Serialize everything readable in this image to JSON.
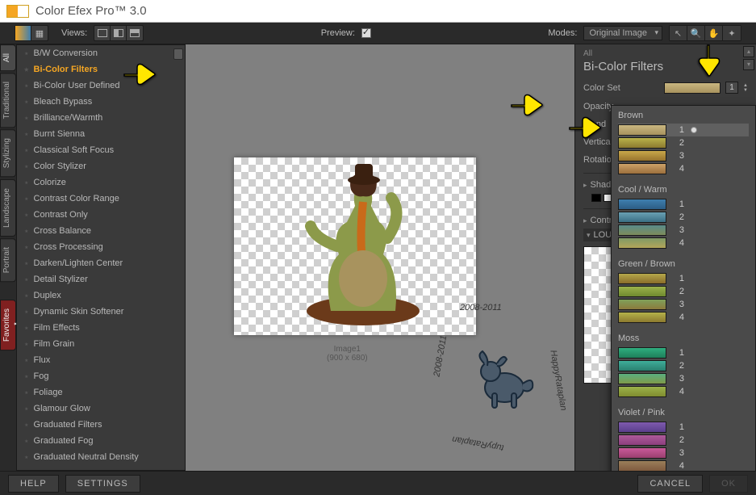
{
  "title": "Color Efex Pro™ 3.0",
  "toolbar": {
    "views_label": "Views:",
    "preview_label": "Preview:",
    "modes_label": "Modes:",
    "modes_value": "Original Image"
  },
  "vtabs": [
    "All",
    "Traditional",
    "Stylizing",
    "Landscape",
    "Portrait"
  ],
  "vtab_fav": "Favorites",
  "filters": [
    "B/W Conversion",
    "Bi-Color Filters",
    "Bi-Color User Defined",
    "Bleach Bypass",
    "Brilliance/Warmth",
    "Burnt Sienna",
    "Classical Soft Focus",
    "Color Stylizer",
    "Colorize",
    "Contrast Color Range",
    "Contrast Only",
    "Cross Balance",
    "Cross Processing",
    "Darken/Lighten Center",
    "Detail Stylizer",
    "Duplex",
    "Dynamic Skin Softener",
    "Film Effects",
    "Film Grain",
    "Flux",
    "Fog",
    "Foliage",
    "Glamour Glow",
    "Graduated Filters",
    "Graduated Fog",
    "Graduated Neutral Density"
  ],
  "selected_filter_index": 1,
  "preview": {
    "name": "Image1",
    "dims": "(900 x 680)"
  },
  "watermark": {
    "y1": "2008-2011",
    "y2": "HappyRataplan",
    "y3": "tupyRataplan",
    "y4": "2008-2011"
  },
  "right": {
    "crumb": "All",
    "title": "Bi-Color Filters",
    "rows": {
      "colorset": "Color Set",
      "opacity": "Opacity",
      "blend": "Blend",
      "vshift": "Vertical Shift",
      "rotation": "Rotation",
      "shadows": "Shadows / Highlights",
      "cpoints": "Control Points",
      "loupe": "LOUPE"
    },
    "colorset_index": "1"
  },
  "popover": {
    "groups": [
      {
        "name": "Brown",
        "swatches": [
          {
            "g": "linear-gradient(to bottom,#c9b680,#a8935e)",
            "n": "1",
            "sel": true
          },
          {
            "g": "linear-gradient(to bottom,#b9b24a,#8c7a2f)",
            "n": "2"
          },
          {
            "g": "linear-gradient(to bottom,#c9a84a,#97732d)",
            "n": "3"
          },
          {
            "g": "linear-gradient(to bottom,#cda268,#9c6f3c)",
            "n": "4"
          }
        ]
      },
      {
        "name": "Cool / Warm",
        "swatches": [
          {
            "g": "linear-gradient(to bottom,#3f7fae,#2c5d85)",
            "n": "1"
          },
          {
            "g": "linear-gradient(to bottom,#6aa0b3,#3a6f84)",
            "n": "2"
          },
          {
            "g": "linear-gradient(to bottom,#5a8b8a,#7d8c5a)",
            "n": "3"
          },
          {
            "g": "linear-gradient(to bottom,#7f9a66,#b2a55a)",
            "n": "4"
          }
        ]
      },
      {
        "name": "Green / Brown",
        "swatches": [
          {
            "g": "linear-gradient(to bottom,#b5a84a,#8a6d2a)",
            "n": "1"
          },
          {
            "g": "linear-gradient(to bottom,#9bb24a,#6f8a2f)",
            "n": "2"
          },
          {
            "g": "linear-gradient(to bottom,#7fa15a,#8c7a3c)",
            "n": "3"
          },
          {
            "g": "linear-gradient(to bottom,#b5b24a,#8c7a2f)",
            "n": "4"
          }
        ]
      },
      {
        "name": "Moss",
        "swatches": [
          {
            "g": "linear-gradient(to bottom,#2fae7f,#1e7f5a)",
            "n": "1"
          },
          {
            "g": "linear-gradient(to bottom,#3fae9a,#2a7f6f)",
            "n": "2"
          },
          {
            "g": "linear-gradient(to bottom,#5aae7f,#7f9a4a)",
            "n": "3"
          },
          {
            "g": "linear-gradient(to bottom,#9bb24a,#7f8c2f)",
            "n": "4"
          }
        ]
      },
      {
        "name": "Violet / Pink",
        "swatches": [
          {
            "g": "linear-gradient(to bottom,#7f5aae,#5a3f8c)",
            "n": "1"
          },
          {
            "g": "linear-gradient(to bottom,#ae5a9a,#8c3f7f)",
            "n": "2"
          },
          {
            "g": "linear-gradient(to bottom,#c95a9a,#9a3f6f)",
            "n": "3"
          },
          {
            "g": "linear-gradient(to bottom,#9a7f5a,#7f5a3f)",
            "n": "4"
          }
        ]
      }
    ]
  },
  "footer": {
    "help": "HELP",
    "settings": "SETTINGS",
    "cancel": "CANCEL",
    "ok": "OK"
  }
}
